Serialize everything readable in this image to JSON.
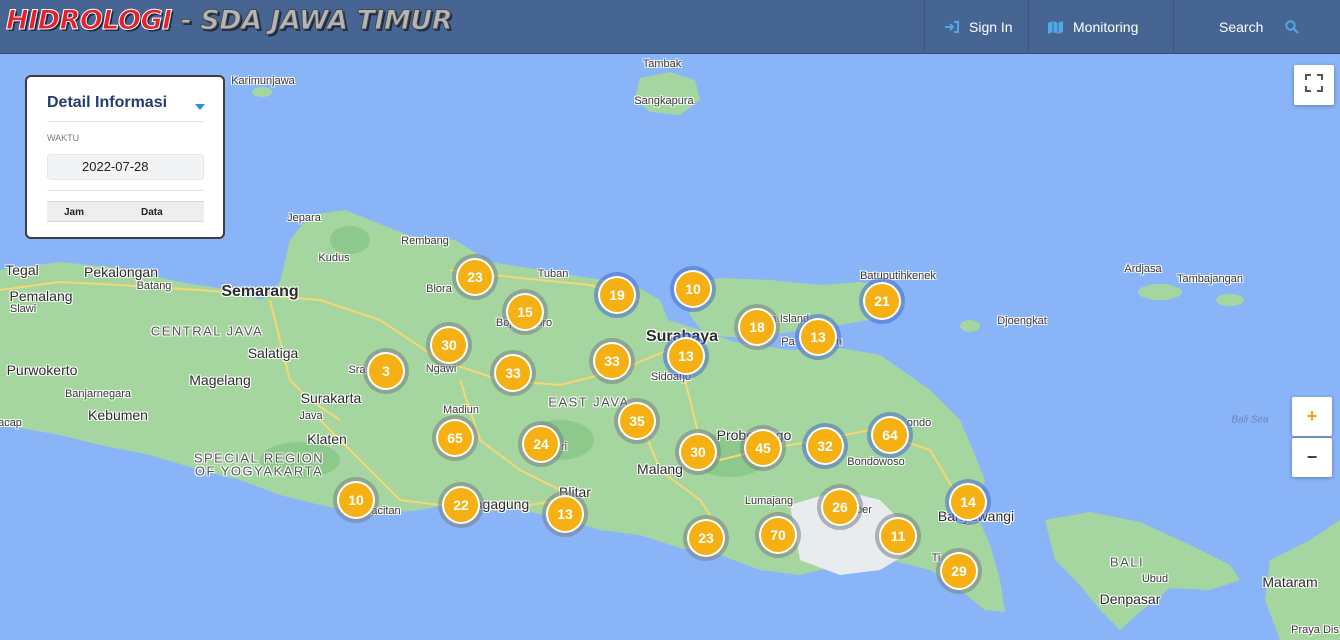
{
  "header": {
    "logo_part1": "HIDROLOGI",
    "logo_part2": " - SDA JAWA TIMUR",
    "nav": {
      "sign_in": "Sign In",
      "monitoring": "Monitoring",
      "search": "Search"
    }
  },
  "panel": {
    "title": "Detail Informasi",
    "waktu_label": "WAKTU",
    "date": "2022-07-28",
    "table_headers": {
      "jam": "Jam",
      "data": "Data"
    }
  },
  "controls": {
    "zoom_in": "+",
    "zoom_out": "−"
  },
  "clusters": [
    {
      "count": "23",
      "style": "grey"
    },
    {
      "count": "15",
      "style": "grey"
    },
    {
      "count": "19",
      "style": "blue"
    },
    {
      "count": "10",
      "style": "blue"
    },
    {
      "count": "18",
      "style": "grey"
    },
    {
      "count": "13",
      "style": "blue"
    },
    {
      "count": "21",
      "style": "blue"
    },
    {
      "count": "30",
      "style": "grey"
    },
    {
      "count": "3",
      "style": "grey"
    },
    {
      "count": "33",
      "style": "grey"
    },
    {
      "count": "33",
      "style": "grey"
    },
    {
      "count": "13",
      "style": "blue"
    },
    {
      "count": "35",
      "style": "grey"
    },
    {
      "count": "65",
      "style": "grey"
    },
    {
      "count": "24",
      "style": "grey"
    },
    {
      "count": "30",
      "style": "grey"
    },
    {
      "count": "45",
      "style": "grey"
    },
    {
      "count": "32",
      "style": "blue"
    },
    {
      "count": "64",
      "style": "blue"
    },
    {
      "count": "10",
      "style": "grey"
    },
    {
      "count": "22",
      "style": "grey"
    },
    {
      "count": "13",
      "style": "grey"
    },
    {
      "count": "26",
      "style": "grey"
    },
    {
      "count": "14",
      "style": "blue"
    },
    {
      "count": "23",
      "style": "grey"
    },
    {
      "count": "70",
      "style": "grey"
    },
    {
      "count": "11",
      "style": "grey"
    },
    {
      "count": "29",
      "style": "grey"
    }
  ],
  "places": {
    "karimunjawa": "Karimunjawa",
    "tambak": "Tambak",
    "sangkapura": "Sangkapura",
    "jepara": "Jepara",
    "rembang": "Rembang",
    "kudus": "Kudus",
    "blora": "Blora",
    "tuban": "Tuban",
    "tegal": "Tegal",
    "pekalongan": "Pekalongan",
    "batang": "Batang",
    "pemalang": "Pemalang",
    "slawi": "Slawi",
    "semarang": "Semarang",
    "central_java": "CENTRAL JAVA",
    "salatiga": "Salatiga",
    "purwokerto": "Purwokerto",
    "magelang": "Magelang",
    "banjarnegara": "Banjarnegara",
    "kebumen": "Kebumen",
    "surakarta": "Surakarta",
    "java": "Java",
    "klaten": "Klaten",
    "special_region_1": "SPECIAL REGION",
    "special_region_2": "OF YOGYAKARTA",
    "ngawi": "Ngawi",
    "madiun": "Madiun",
    "east_java": "EAST JAVA",
    "surabaya": "Surabaya",
    "sidoarjo": "Sidoarjo",
    "malang": "Malang",
    "blitar": "Blitar",
    "tulungagung": "ngagung",
    "probolinggo": "Probolinggo",
    "bondowoso": "Bondowoso",
    "lumajang": "Lumajang",
    "banyuwangi": "Banyuwangi",
    "batuputihkenek": "Batuputihkenek",
    "ardjasa": "Ardjasa",
    "tambajangan": "Tambajangan",
    "djoengkat": "Djoengkat",
    "bali_sea": "Bali Sea",
    "bali": "BALI",
    "ubud": "Ubud",
    "denpasar": "Denpasar",
    "mataram": "Mataram",
    "pacitan": "acitan",
    "bojonegoro_part": "Bojonegoro",
    "cilacap": "acap",
    "sra": "Sra",
    "ri": "ri",
    "ber": "ber",
    "ti": "Ti",
    "ondo": "ondo",
    "raisland": "ra Island",
    "pan": "Pa",
    "an": "an",
    "lombok_part": "Praya Dis"
  }
}
